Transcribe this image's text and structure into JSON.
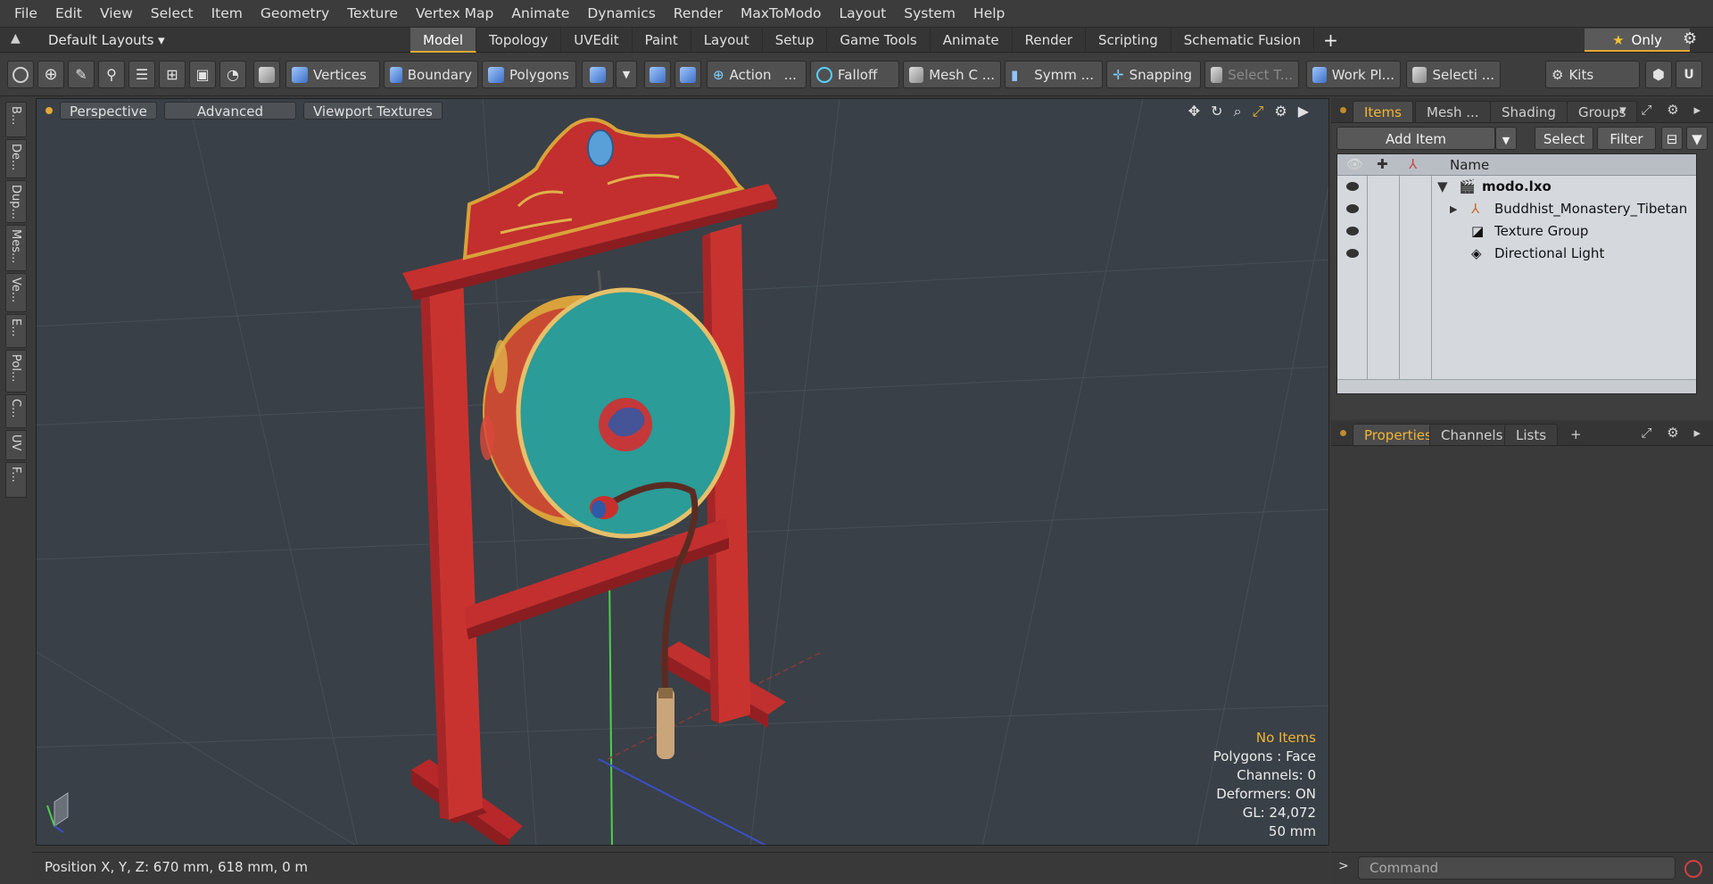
{
  "menu": [
    "File",
    "Edit",
    "View",
    "Select",
    "Item",
    "Geometry",
    "Texture",
    "Vertex Map",
    "Animate",
    "Dynamics",
    "Render",
    "MaxToModo",
    "Layout",
    "System",
    "Help"
  ],
  "layouts_label": "Default Layouts ▾",
  "layout_tabs": [
    "Model",
    "Topology",
    "UVEdit",
    "Paint",
    "Layout",
    "Setup",
    "Game Tools",
    "Animate",
    "Render",
    "Scripting",
    "Schematic Fusion"
  ],
  "active_layout_tab": "Model",
  "add_tab_label": "+",
  "only_label": "Only",
  "toolbar": {
    "vertices": "Vertices",
    "boundary": "Boundary",
    "polygons": "Polygons",
    "action": "Action",
    "action_more": "...",
    "falloff": "Falloff",
    "mesh": "Mesh C ...",
    "symmetry": "Symm ...",
    "snapping": "Snapping",
    "select_t": "Select T...",
    "workplane": "Work Pl...",
    "selection": "Selecti ...",
    "kits": "Kits"
  },
  "left_tabs": [
    "B...",
    "De...",
    "Dup...",
    "Mes...",
    "Ve...",
    "E...",
    "Pol...",
    "C...",
    "UV",
    "F..."
  ],
  "viewport": {
    "view": "Perspective",
    "shading": "Advanced",
    "textures": "Viewport Textures",
    "info": {
      "items": "No Items",
      "polygons": "Polygons : Face",
      "channels": "Channels: 0",
      "deformers": "Deformers: ON",
      "gl": "GL: 24,072",
      "scale": "50 mm"
    }
  },
  "status": {
    "position": "Position X, Y, Z:   670 mm, 618 mm, 0 m"
  },
  "items_panel": {
    "tabs": [
      "Items",
      "Mesh ...",
      "Shading",
      "Groups"
    ],
    "active": "Items",
    "add_item": "Add Item",
    "select": "Select",
    "filter": "Filter",
    "name_header": "Name",
    "rows": [
      {
        "label": "modo.lxo"
      },
      {
        "label": "Buddhist_Monastery_Tibetan ..."
      },
      {
        "label": "Texture Group"
      },
      {
        "label": "Directional Light"
      }
    ]
  },
  "props_panel": {
    "tabs": [
      "Properties",
      "Channels",
      "Lists"
    ],
    "active": "Properties",
    "add": "+"
  },
  "command": {
    "placeholder": "Command"
  },
  "colors": {
    "accent": "#e5a832",
    "frame_red": "#c9332f",
    "drum_teal": "#2b9c97",
    "viewport_bg": "#394047"
  }
}
